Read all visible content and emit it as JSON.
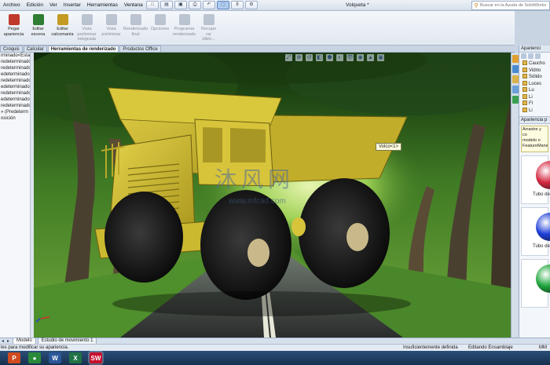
{
  "menu": {
    "items": [
      "Archivo",
      "Edición",
      "Ver",
      "Insertar",
      "Herramientas",
      "Ventana"
    ],
    "pin_icon": "pin-icon"
  },
  "quick_access": {
    "icons": [
      "new-document-icon",
      "open-icon",
      "save-icon",
      "print-icon",
      "undo-icon",
      "select-icon",
      "rebuild-icon",
      "options-icon"
    ]
  },
  "document_title": "Volqueta *",
  "search": {
    "placeholder": "Buscar en la Ayuda de SolidWorks"
  },
  "ribbon": {
    "buttons": [
      {
        "label": "Pegar\napariencia",
        "icon": "paste-appearance-icon",
        "enabled": true,
        "color": "#c0392b"
      },
      {
        "label": "Editar\nescena",
        "icon": "edit-scene-icon",
        "enabled": true,
        "color": "#2e7d32"
      },
      {
        "label": "Editar\ncalcomanía",
        "icon": "edit-decal-icon",
        "enabled": true,
        "color": "#c49a22"
      },
      {
        "label": "Vista\npreliminar\nintegrada",
        "icon": "integrated-preview-icon",
        "enabled": false,
        "color": "#7a8aa0"
      },
      {
        "label": "Vista\npreliminar",
        "icon": "preview-window-icon",
        "enabled": false,
        "color": "#7a8aa0"
      },
      {
        "label": "Renderizado\nfinal",
        "icon": "final-render-icon",
        "enabled": false,
        "color": "#7a8aa0"
      },
      {
        "label": "Opciones",
        "icon": "options-icon",
        "enabled": false,
        "color": "#7a8aa0"
      },
      {
        "label": "Programar\nrenderizado",
        "icon": "schedule-render-icon",
        "enabled": false,
        "color": "#7a8aa0"
      },
      {
        "label": "Recupe\nrar\núltim...",
        "icon": "recall-last-render-icon",
        "enabled": false,
        "color": "#7a8aa0"
      }
    ]
  },
  "command_tabs": [
    {
      "label": "Croquis",
      "active": false
    },
    {
      "label": "Calcular",
      "active": false
    },
    {
      "label": "Herramientas de renderizado",
      "active": true
    },
    {
      "label": "Productos Office",
      "active": false
    }
  ],
  "feature_tree": {
    "rows": [
      "rminado<Esta",
      "",
      "",
      "",
      "",
      "",
      "",
      "",
      "",
      "",
      "",
      "redeterminado",
      "redeterminado",
      "edeterminado",
      "redeterminado",
      "edeterminado",
      "redeterminado",
      "edeterminado",
      "redeterminado",
      "» (Predeterm",
      "osición"
    ]
  },
  "viewport": {
    "view_tools": [
      "zoom-to-fit-icon",
      "zoom-area-icon",
      "previous-view-icon",
      "section-view-icon",
      "view-orientation-icon",
      "display-style-icon",
      "hide-show-icon",
      "edit-appearance-icon",
      "scene-icon",
      "view-settings-icon"
    ],
    "tag_label": "Volco<1>",
    "watermark_cn": "沐风网",
    "watermark_url": "www.mfcad.com"
  },
  "right_panel": {
    "header": "Aparienci",
    "tree": [
      "Caucho",
      "Vidrio",
      "Sólido",
      "Luces",
      "Lu",
      "Li",
      "Fl",
      "Li"
    ],
    "appearance_title": "Apariencia p",
    "hint": "Arrastre y co\nmodelo o\nFeatureMana",
    "swatches": [
      {
        "label": "Tubo de",
        "color": "#d42840"
      },
      {
        "label": "Tubo de",
        "color": "#1f3fd8"
      },
      {
        "label": "",
        "color": "#1ea63c"
      }
    ]
  },
  "bottom_tabs": [
    {
      "label": "Modelo",
      "active": true
    },
    {
      "label": "Estudio de movimiento 1",
      "active": false
    }
  ],
  "status": {
    "hint": "les para modificar su apariencia.",
    "definition": "Insuficientemente definida",
    "mode": "Editando Ensamblaje",
    "units": "MM"
  },
  "taskbar": {
    "apps": [
      {
        "name": "powerpoint",
        "glyph": "P",
        "color": "#d04a1e"
      },
      {
        "name": "chrome",
        "glyph": "●",
        "color": "#2a8a3a"
      },
      {
        "name": "word",
        "glyph": "W",
        "color": "#2b579a"
      },
      {
        "name": "excel",
        "glyph": "X",
        "color": "#217346"
      },
      {
        "name": "solidworks",
        "glyph": "SW",
        "color": "#c8102e"
      }
    ]
  }
}
